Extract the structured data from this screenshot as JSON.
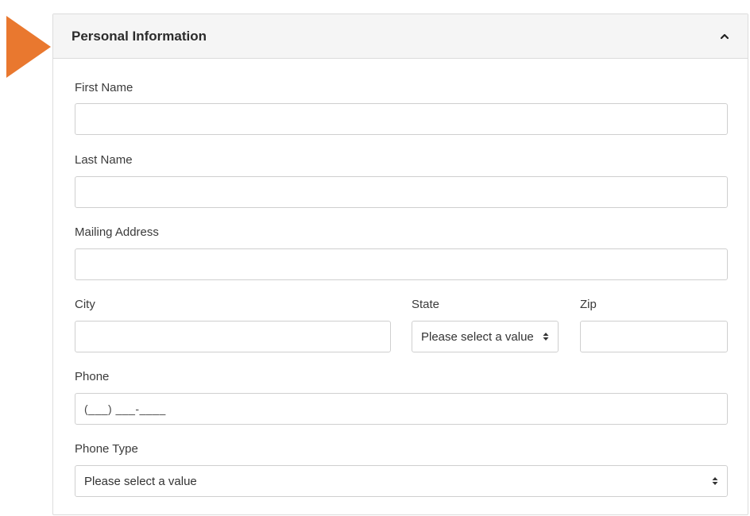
{
  "section": {
    "title": "Personal Information",
    "collapse_icon": "chevron-up-icon"
  },
  "accent_color": "#e9782f",
  "fields": {
    "first_name": {
      "label": "First Name",
      "value": ""
    },
    "last_name": {
      "label": "Last Name",
      "value": ""
    },
    "mailing_address": {
      "label": "Mailing Address",
      "value": ""
    },
    "city": {
      "label": "City",
      "value": ""
    },
    "state": {
      "label": "State",
      "selected": "Please select a value",
      "icon": "sort-icon"
    },
    "zip": {
      "label": "Zip",
      "value": ""
    },
    "phone": {
      "label": "Phone",
      "mask": "(___) ___-____"
    },
    "phone_type": {
      "label": "Phone Type",
      "selected": "Please select a value",
      "icon": "sort-icon"
    }
  }
}
